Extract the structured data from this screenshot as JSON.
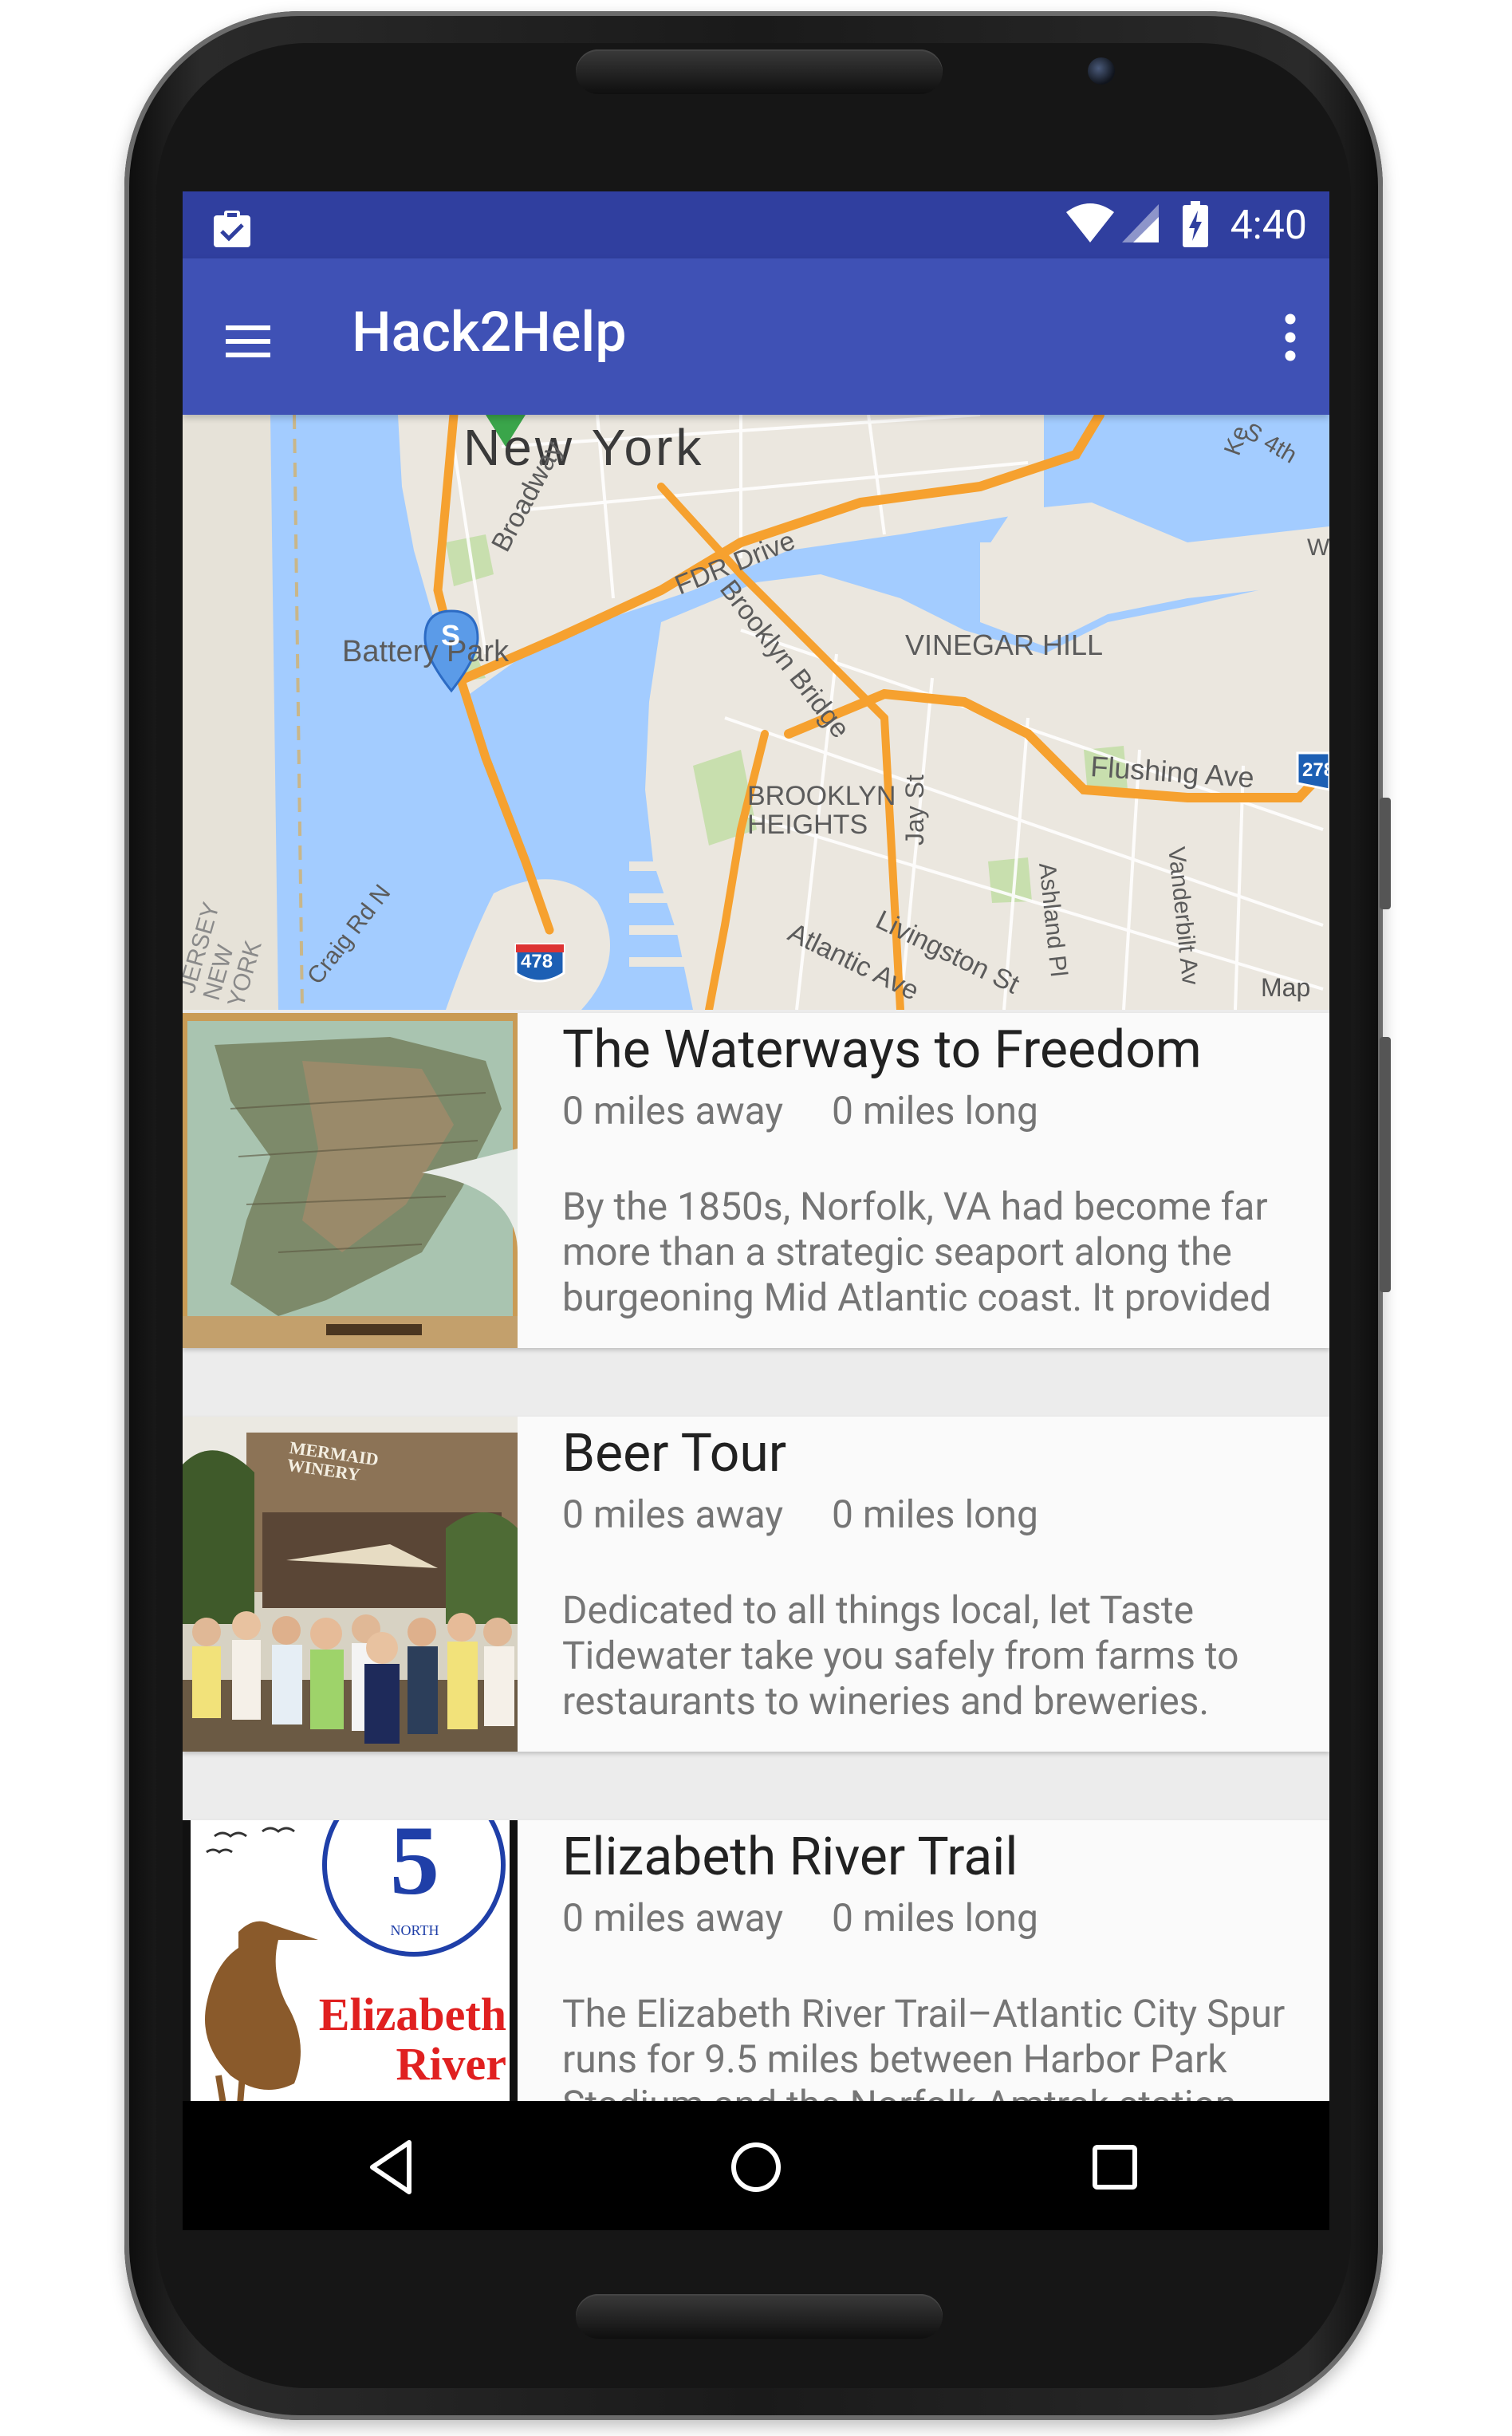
{
  "status_bar": {
    "time": "4:40"
  },
  "toolbar": {
    "title": "Hack2Help"
  },
  "map": {
    "labels": {
      "new_york": "New York",
      "broadway": "Broadway",
      "fdr_drive": "FDR Drive",
      "brooklyn_bridge": "Brooklyn Bridge",
      "battery_park": "Battery Park",
      "vinegar_hill": "VINEGAR HILL",
      "flushing_ave": "Flushing Ave",
      "brooklyn_heights": "BROOKLYN HEIGHTS",
      "jay_st": "Jay St",
      "atlantic_ave": "Atlantic Ave",
      "livingston_st": "Livingston St",
      "ashland_pl": "Ashland Pl",
      "vanderbilt_av": "Vanderbilt Av",
      "craig_rd_n": "Craig Rd N",
      "jersey_new_york": "JERSEY NEW YORK",
      "s_4th": "S 4th",
      "kent": "Ke",
      "w": "W",
      "interstate_478": "478",
      "interstate_278": "278",
      "marker_letter": "S",
      "map_type_label": "Map"
    }
  },
  "trails": [
    {
      "title": "The Waterways to Freedom",
      "distance_away": "0 miles away",
      "length": "0 miles long",
      "description": "By the 1850s, Norfolk, VA had become far more than a strategic seaport along the burgeoning Mid Atlantic coast. It provided"
    },
    {
      "title": "Beer Tour",
      "distance_away": "0 miles away",
      "length": "0 miles long",
      "description": "Dedicated to all things local, let Taste Tidewater take you safely from farms to restaurants to wineries and breweries.",
      "image_sign": "MERMAID WINERY"
    },
    {
      "title": "Elizabeth River Trail",
      "distance_away": "0 miles away",
      "length": "0 miles long",
      "description": "The Elizabeth River Trail–Atlantic City Spur runs for 9.5 miles between Harbor Park Stadium and the Norfolk Amtrak station.",
      "logo_number": "5",
      "logo_subtext": "NORTH",
      "logo_line1": "Elizabeth",
      "logo_line2": "River"
    }
  ],
  "colors": {
    "primary": "#3f51b5",
    "primary_dark": "#303f9f",
    "water": "#a3ccff",
    "land": "#ebe7df",
    "road": "#f6a12f"
  }
}
